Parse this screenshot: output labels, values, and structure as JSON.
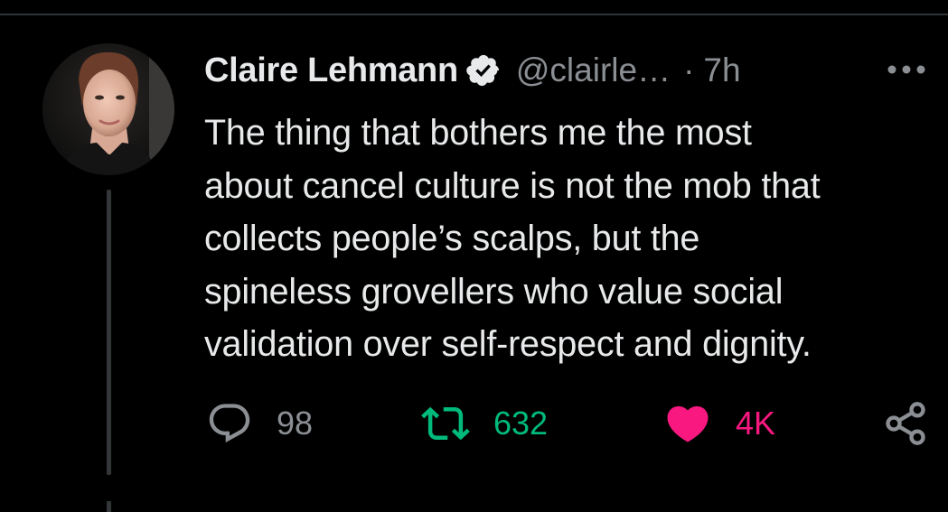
{
  "tweet": {
    "author": {
      "display_name": "Claire Lehmann",
      "handle": "@clairle…",
      "verified": true
    },
    "separator": "·",
    "time": "7h",
    "text": "The thing that bothers me the most\nabout cancel culture is not the mob that\ncollects people’s scalps, but the\nspineless grovellers who value social\nvalidation over self-respect and dignity.",
    "actions": {
      "replies": "98",
      "retweets": "632",
      "likes": "4K"
    },
    "liked": true
  },
  "icons": {
    "verified": "verified-badge-icon",
    "more": "more-options-icon",
    "reply": "reply-icon",
    "retweet": "retweet-icon",
    "like": "heart-icon",
    "share": "share-icon"
  },
  "colors": {
    "background": "#000000",
    "text": "#e7e9ea",
    "secondary": "#8b8f94",
    "retweet": "#00ba7c",
    "like": "#f91880"
  }
}
